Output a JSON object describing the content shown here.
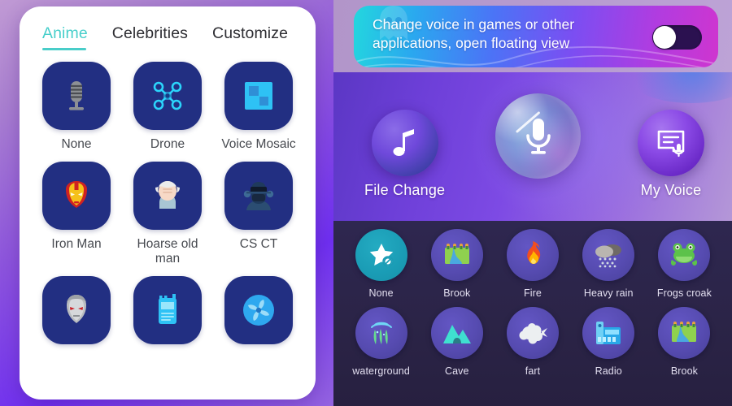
{
  "left_panel": {
    "tabs": [
      {
        "label": "Anime",
        "active": true
      },
      {
        "label": "Celebrities",
        "active": false
      },
      {
        "label": "Customize",
        "active": false
      }
    ],
    "accent_color": "#49cdc9",
    "tile_color": "#222f82",
    "voices": [
      {
        "label": "None",
        "icon": "microphone-icon"
      },
      {
        "label": "Drone",
        "icon": "drone-icon"
      },
      {
        "label": "Voice Mosaic",
        "icon": "mosaic-icon"
      },
      {
        "label": "Iron Man",
        "icon": "iron-man-icon"
      },
      {
        "label": "Hoarse old man",
        "icon": "old-man-icon"
      },
      {
        "label": "CS CT",
        "icon": "counter-terrorist-icon"
      },
      {
        "label": "",
        "icon": "megatron-icon"
      },
      {
        "label": "",
        "icon": "walkie-talkie-icon"
      },
      {
        "label": "",
        "icon": "fan-icon"
      }
    ]
  },
  "right_panel": {
    "banner": {
      "text_line1": "Change voice in games or other",
      "text_line2": "applications, open floating view",
      "toggle_on": false,
      "toggle_name": "floating-view-toggle"
    },
    "modes": [
      {
        "label": "File Change",
        "icon": "music-note-icon"
      },
      {
        "label": "",
        "icon": "microphone-icon"
      },
      {
        "label": "My Voice",
        "icon": "voice-document-icon"
      }
    ],
    "effects": [
      {
        "label": "None",
        "icon": "star-blocked-icon",
        "selected": true
      },
      {
        "label": "Brook",
        "icon": "brook-icon",
        "selected": false
      },
      {
        "label": "Fire",
        "icon": "fire-icon",
        "selected": false
      },
      {
        "label": "Heavy rain",
        "icon": "rain-cloud-icon",
        "selected": false
      },
      {
        "label": "Frogs croak",
        "icon": "frog-icon",
        "selected": false
      },
      {
        "label": "waterground",
        "icon": "waterground-icon",
        "selected": false
      },
      {
        "label": "Cave",
        "icon": "cave-icon",
        "selected": false
      },
      {
        "label": "fart",
        "icon": "cloud-puff-icon",
        "selected": false
      },
      {
        "label": "Radio",
        "icon": "radio-icon",
        "selected": false
      },
      {
        "label": "Brook",
        "icon": "brook-icon",
        "selected": false
      }
    ],
    "selected_color": "#1a9cb5"
  }
}
